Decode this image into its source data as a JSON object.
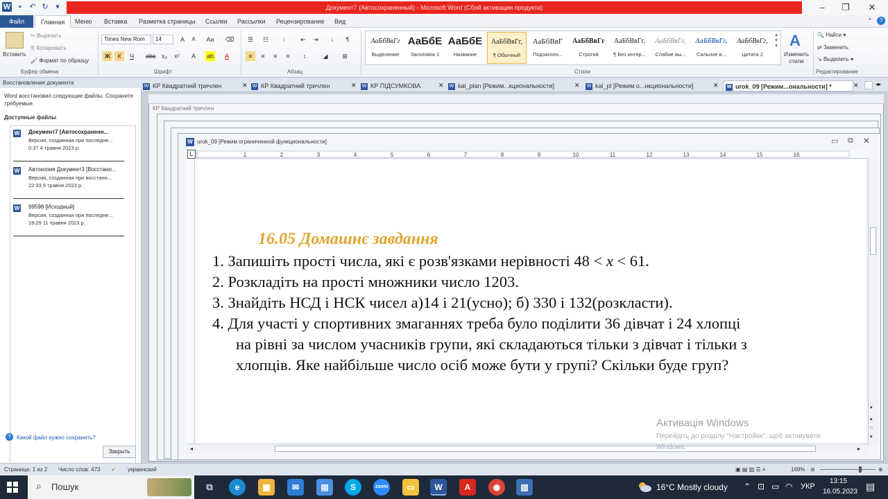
{
  "window": {
    "title": "Документ7 (Автосохраненный) - Microsoft Word (Сбой активации продукта)"
  },
  "ribbon_tabs": [
    "Файл",
    "Главная",
    "Меню",
    "Вставка",
    "Разметка страницы",
    "Ссылки",
    "Рассылки",
    "Рецензирование",
    "Вид"
  ],
  "clipboard": {
    "paste": "Вставить",
    "cut": "Вырезать",
    "copy": "Копировать",
    "format_painter": "Формат по образцу",
    "group": "Буфер обмена"
  },
  "font": {
    "name": "Times New Rom",
    "size": "14",
    "group": "Шрифт"
  },
  "paragraph": {
    "group": "Абзац"
  },
  "styles": {
    "group": "Стили",
    "tiles": [
      {
        "preview": "АаБбВвГг",
        "name": "Выделение"
      },
      {
        "preview": "АаБбЕ",
        "name": "Заголовок 1"
      },
      {
        "preview": "АаБбЕ",
        "name": "Название"
      },
      {
        "preview": "АаБбВвГг,",
        "name": "¶ Обычный"
      },
      {
        "preview": "АаБбВвГ",
        "name": "Подзаголо..."
      },
      {
        "preview": "АаБбВвГг",
        "name": "Строгий"
      },
      {
        "preview": "АаБбВвГг,",
        "name": "¶ Без интер..."
      },
      {
        "preview": "АаБбВвГг,",
        "name": "Слабое вы..."
      },
      {
        "preview": "АаБбВвГг,",
        "name": "Сильное в..."
      },
      {
        "preview": "АаБбВвГг,",
        "name": "Цитата 2"
      }
    ],
    "change": "Изменить стили"
  },
  "editing": {
    "group": "Редактирование",
    "find": "Найти",
    "replace": "Заменить",
    "select": "Выделить"
  },
  "recovery": {
    "header": "Восстановление документа",
    "message": "Word восстановил следующие файлы. Сохраните требуемые.",
    "available": "Доступные файлы",
    "items": [
      {
        "title": "Документ7 [Автосохраненн...",
        "line1": "Версия, созданная при последне...",
        "line2": "0:37 4 травня 2023 р."
      },
      {
        "title": "Автокопия Документ3 [Восстано...",
        "line1": "Версия, созданная при восстано...",
        "line2": "22:33 9 травня 2023 р."
      },
      {
        "title": "99598 [Исходный]",
        "line1": "Версия, созданная при последне...",
        "line2": "19:29 11 травня 2023 р."
      }
    ],
    "help": "Какой файл нужно сохранить?",
    "close": "Закрыть"
  },
  "doc_tabs": [
    "КР  Квадратний тричлен",
    "КР  Квадратний тричлен",
    "КР  ПІДСУМКОВА",
    "kal_plan [Режим...кциональности]",
    "kal_pl [Режим о...нкциональности]",
    "urok_09 [Режим...ональности]  *"
  ],
  "back_doc_title": "КР   Квадратний тричлен",
  "doc_window_title": "urok_09 [Режим ограниченной функциональности]",
  "document": {
    "heading": "16.05   Домашнє завдання",
    "lines": [
      "1.  Запишіть прості числа, які є розв'язками нерівності 48 < x < 61.",
      "2.  Розкладіть на прості множники число 1203.",
      "3.  Знайдіть НСД і НСК чисел а)14 і 21(усно); б) 330 і 132(розкласти).",
      "4.  Для участі у спортивних змаганнях треба було поділити 36 дівчат і 24 хлопці",
      "на рівні за числом учасників групи, які складаються тільки з дівчат і тільки з",
      "хлопців. Яке найбільше число осіб може бути у групі? Скільки буде груп?"
    ]
  },
  "watermark": {
    "title": "Активація Windows",
    "line1": "Перейдіть до розділу \"Настройки\", щоб активувати",
    "line2": "Windows."
  },
  "status": {
    "page": "Страница: 1 из 2",
    "words": "Число слов: 473",
    "lang": "украинский",
    "zoom": "169%"
  },
  "taskbar": {
    "search": "Пошук",
    "weather": "16°C  Mostly cloudy",
    "lang": "УКР",
    "time": "13:15",
    "date": "16.05.2023"
  },
  "colors": {
    "title_red": "#e8261d",
    "heading_orange": "#e0a52e",
    "word_blue": "#2b579a"
  }
}
